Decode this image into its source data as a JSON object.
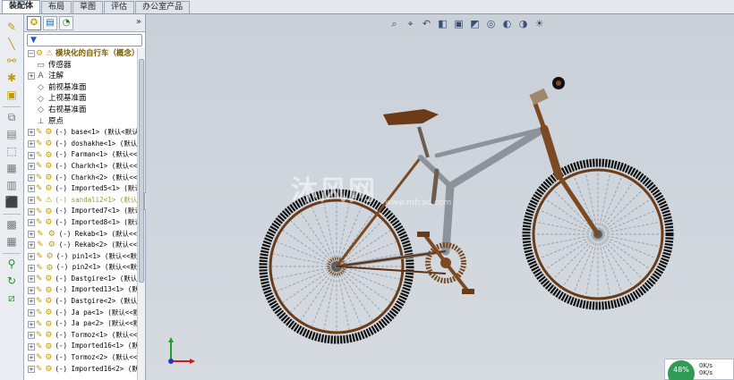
{
  "tabs": [
    {
      "label": "装配体",
      "active": true
    },
    {
      "label": "布局",
      "active": false
    },
    {
      "label": "草图",
      "active": false
    },
    {
      "label": "评估",
      "active": false
    },
    {
      "label": "办公室产品",
      "active": false
    }
  ],
  "feature_manager": {
    "filter_icon": "funnel-icon",
    "expand_glyph": "»",
    "root_label": "模块化的自行车（概念）",
    "rows": [
      {
        "exp": "",
        "icon": "sensor-folder-icon",
        "label": "传感器",
        "mono": false,
        "ghost": false
      },
      {
        "exp": "+",
        "icon": "annotation-icon",
        "label": "注解",
        "mono": false,
        "ghost": false
      },
      {
        "exp": "",
        "icon": "plane-icon",
        "label": "前视基准面",
        "mono": false,
        "ghost": false
      },
      {
        "exp": "",
        "icon": "plane-icon",
        "label": "上视基准面",
        "mono": false,
        "ghost": false
      },
      {
        "exp": "",
        "icon": "plane-icon",
        "label": "右视基准面",
        "mono": false,
        "ghost": false
      },
      {
        "exp": "",
        "icon": "origin-icon",
        "label": "原点",
        "mono": false,
        "ghost": false
      },
      {
        "exp": "+",
        "icon": "component-icon",
        "label": "(-) base<1> (默认<默认",
        "mono": true,
        "ghost": false
      },
      {
        "exp": "+",
        "icon": "component-icon",
        "label": "(-) doshakhe<1> (默认<",
        "mono": true,
        "ghost": false
      },
      {
        "exp": "+",
        "icon": "component-icon",
        "label": "(-) Farman<1> (默认<<",
        "mono": true,
        "ghost": false
      },
      {
        "exp": "+",
        "icon": "component-icon",
        "label": "(-) Charkh<1> (默认<<",
        "mono": true,
        "ghost": false
      },
      {
        "exp": "+",
        "icon": "component-icon",
        "label": "(-) Charkh<2> (默认<<",
        "mono": true,
        "ghost": false
      },
      {
        "exp": "+",
        "icon": "component-icon",
        "label": "(-) Imported5<1> (默认",
        "mono": true,
        "ghost": false
      },
      {
        "exp": "+",
        "icon": "warning-component-icon",
        "label": "(-) sandali2<1> (默认",
        "mono": true,
        "ghost": true
      },
      {
        "exp": "+",
        "icon": "component-icon",
        "label": "(-) Imported7<1> (默认",
        "mono": true,
        "ghost": false
      },
      {
        "exp": "+",
        "icon": "component-icon",
        "label": "(-) Imported8<1> (默认",
        "mono": true,
        "ghost": false
      },
      {
        "exp": "+",
        "icon": "component-icon",
        "label": "(-) Rekab<1> (默认<<",
        "mono": true,
        "ghost": false
      },
      {
        "exp": "+",
        "icon": "component-icon",
        "label": "(-) Rekab<2> (默认<<",
        "mono": true,
        "ghost": false
      },
      {
        "exp": "+",
        "icon": "component-icon",
        "label": "(-) pin1<1> (默认<<默",
        "mono": true,
        "ghost": false
      },
      {
        "exp": "+",
        "icon": "component-icon",
        "label": "(-) pin2<1> (默认<<默",
        "mono": true,
        "ghost": false
      },
      {
        "exp": "+",
        "icon": "component-icon",
        "label": "(-) Dastgire<1> (默认<",
        "mono": true,
        "ghost": false
      },
      {
        "exp": "+",
        "icon": "component-icon",
        "label": "(-) Imported13<1> (默认",
        "mono": true,
        "ghost": false
      },
      {
        "exp": "+",
        "icon": "component-icon",
        "label": "(-) Dastgire<2> (默认<",
        "mono": true,
        "ghost": false
      },
      {
        "exp": "+",
        "icon": "component-icon",
        "label": "(-) Ja pa<1> (默认<<默",
        "mono": true,
        "ghost": false
      },
      {
        "exp": "+",
        "icon": "component-icon",
        "label": "(-) Ja pa<2> (默认<<默",
        "mono": true,
        "ghost": false
      },
      {
        "exp": "+",
        "icon": "component-icon",
        "label": "(-) Tormoz<1> (默认<<",
        "mono": true,
        "ghost": false
      },
      {
        "exp": "+",
        "icon": "component-icon",
        "label": "(-) Imported16<1> (默认",
        "mono": true,
        "ghost": false
      },
      {
        "exp": "+",
        "icon": "component-icon",
        "label": "(-) Tormoz<2> (默认<<",
        "mono": true,
        "ghost": false
      },
      {
        "exp": "+",
        "icon": "component-icon",
        "label": "(-) Imported16<2> (默认",
        "mono": true,
        "ghost": false
      }
    ]
  },
  "command_bar": [
    {
      "icon": "smart-fasteners-icon",
      "glyph": "✎"
    },
    {
      "icon": "line-icon",
      "glyph": "╲"
    },
    {
      "icon": "mate-icon",
      "glyph": "⚯"
    },
    {
      "icon": "reference-point-icon",
      "glyph": "✱"
    },
    {
      "icon": "insert-component-icon",
      "glyph": "▣"
    },
    {
      "icon": "move-component-icon",
      "glyph": "⧉"
    },
    {
      "icon": "rotate-component-icon",
      "glyph": "▤"
    },
    {
      "icon": "pattern-icon",
      "glyph": "⬚"
    },
    {
      "icon": "explode-view-icon",
      "glyph": "▦"
    },
    {
      "icon": "section-icon",
      "glyph": "▥"
    },
    {
      "icon": "interference-icon",
      "glyph": "⬛"
    },
    {
      "icon": "assembly-features-icon",
      "glyph": "▩"
    },
    {
      "icon": "hide-show-icon",
      "glyph": "▦"
    },
    {
      "icon": "measure-icon",
      "glyph": "⚲"
    },
    {
      "icon": "motion-icon",
      "glyph": "↻"
    },
    {
      "icon": "linear-pattern-icon",
      "glyph": "⧄"
    }
  ],
  "view_toolbar": [
    "zoom-fit-icon",
    "zoom-area-icon",
    "previous-view-icon",
    "section-view-icon",
    "view-orientation-icon",
    "display-style-icon",
    "hide-show-items-icon",
    "edit-appearance-icon",
    "apply-scene-icon",
    "view-settings-icon"
  ],
  "watermark": {
    "main": "沐风网",
    "sub": "www.mfcad.com"
  },
  "status": {
    "percent": "48%",
    "rate": "0K/s",
    "rate2": "0K/s"
  },
  "colors": {
    "frame": "#8c939b",
    "fork": "#7b4a22",
    "tire": "#111111",
    "rim": "#6b3c17"
  }
}
